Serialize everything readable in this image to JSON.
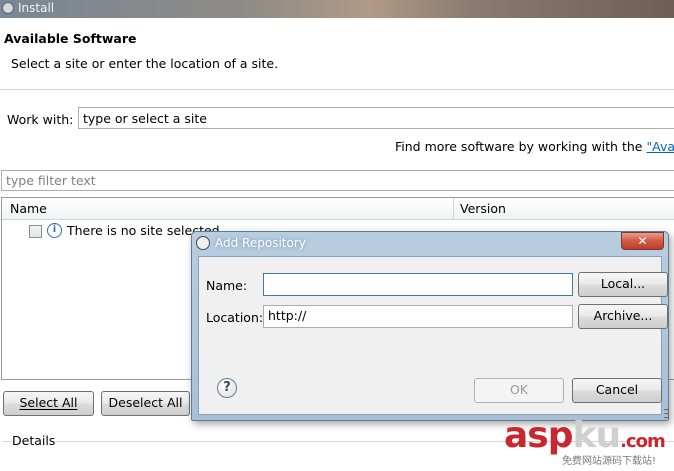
{
  "window": {
    "title": "Install"
  },
  "header": {
    "heading": "Available Software",
    "subheading": "Select a site or enter the location of a site."
  },
  "work_with": {
    "label": "Work with:",
    "value": "type or select a site"
  },
  "find_more": {
    "text": "Find more software by working with the ",
    "link": "\"Availab"
  },
  "filter": {
    "placeholder": "type filter text"
  },
  "table": {
    "columns": [
      "Name",
      "Version"
    ],
    "rows": [
      {
        "checked": false,
        "icon": "info-icon",
        "text": "There is no site selected."
      }
    ]
  },
  "buttons": {
    "select_all": "Select All",
    "deselect_all": "Deselect All"
  },
  "details": {
    "label": "Details"
  },
  "dialog": {
    "title": "Add Repository",
    "close_glyph": "✕",
    "name_label": "Name:",
    "name_value": "",
    "location_label": "Location:",
    "location_value": "http://",
    "local_button": "Local...",
    "archive_button": "Archive...",
    "help_glyph": "?",
    "ok_button": "OK",
    "cancel_button": "Cancel"
  },
  "watermark": {
    "asp": "asp",
    "ku": "ku",
    "com": ".com",
    "subtitle": "免费网站源码下载站!"
  },
  "colors": {
    "link": "#0066cc",
    "info_icon": "#2a6cc0",
    "dialog_frame": "#b9cde1",
    "close_button": "#c0392b",
    "watermark_red": "#c8272d"
  }
}
